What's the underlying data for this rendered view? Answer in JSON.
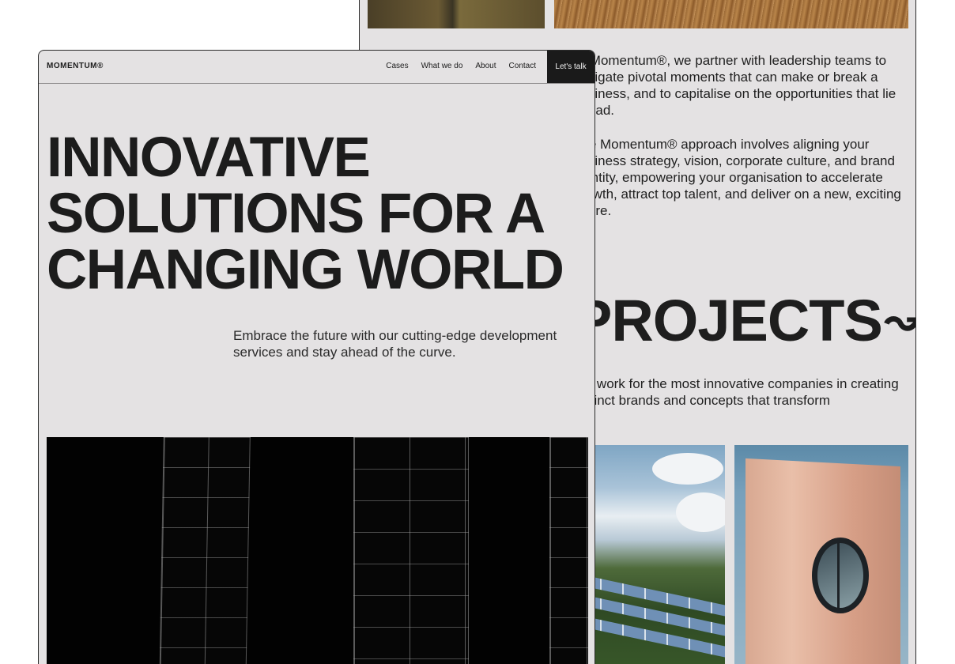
{
  "back_page": {
    "paragraph_1": "At Momentum®, we partner with leadership teams to navigate pivotal moments that can make or break a business, and to capitalise on the opportunities that lie ahead.",
    "paragraph_2": "The Momentum® approach involves aligning your business strategy, vision, corporate culture, and brand identity, empowering your organisation to accelerate growth, attract top talent, and deliver on a new, exciting future.",
    "projects_title": "PROJECTS",
    "projects_arrow": "↝",
    "projects_intro": "We work for the most innovative companies in creating distinct brands and concepts that transform"
  },
  "front_page": {
    "nav": {
      "logo": "MOMENTUM®",
      "links": [
        "Cases",
        "What we do",
        "About",
        "Contact"
      ],
      "cta": "Let's talk"
    },
    "hero": {
      "title": "INNOVATIVE SOLUTIONS FOR A CHANGING WORLD",
      "subtitle": "Embrace the future with our cutting-edge development services and stay ahead of the curve."
    }
  }
}
